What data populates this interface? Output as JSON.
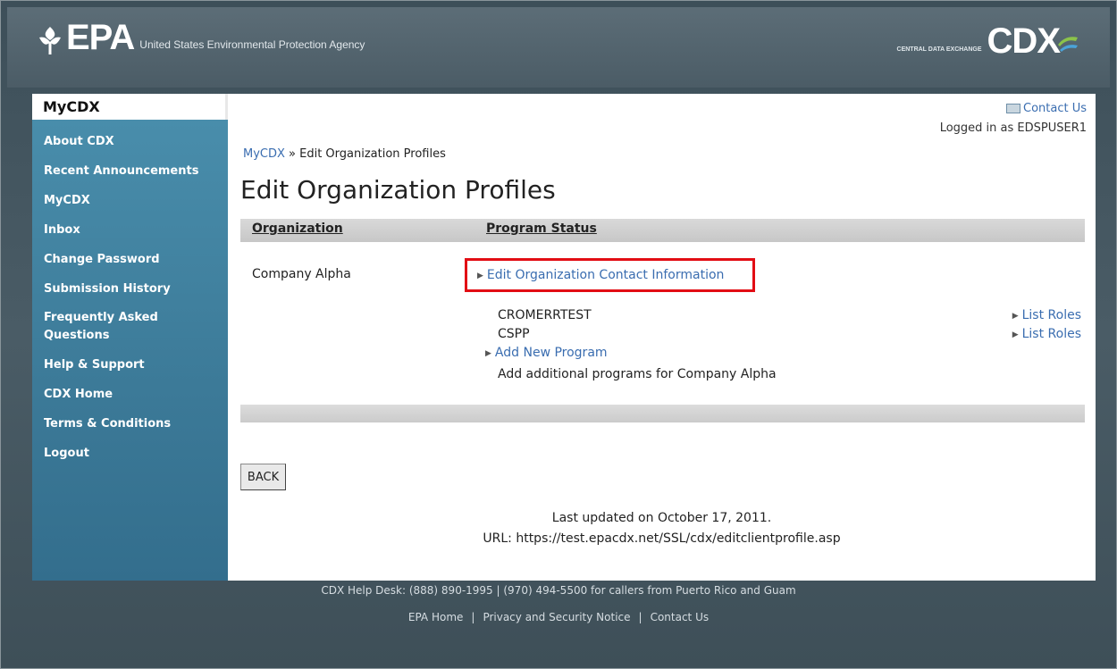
{
  "header": {
    "epa_word": "EPA",
    "epa_name": "United States Environmental Protection Agency",
    "cdx_sub": "CENTRAL DATA EXCHANGE",
    "cdx_word": "CDX"
  },
  "sidebar": {
    "title": "MyCDX",
    "items": [
      {
        "label": "About CDX"
      },
      {
        "label": "Recent Announcements"
      },
      {
        "label": "MyCDX"
      },
      {
        "label": "Inbox"
      },
      {
        "label": "Change Password"
      },
      {
        "label": "Submission History"
      },
      {
        "label": "Frequently Asked Questions"
      },
      {
        "label": "Help & Support"
      },
      {
        "label": "CDX Home"
      },
      {
        "label": "Terms & Conditions"
      },
      {
        "label": "Logout"
      }
    ]
  },
  "top": {
    "contact_us": "Contact Us",
    "logged_in": "Logged in as EDSPUSER1"
  },
  "breadcrumb": {
    "home": "MyCDX",
    "sep": " » ",
    "current": "Edit Organization Profiles"
  },
  "page": {
    "title": "Edit Organization Profiles",
    "col_organization": "Organization",
    "col_program_status": "Program Status",
    "organization": "Company Alpha",
    "edit_link": "Edit Organization Contact Information",
    "programs": [
      {
        "name": "CROMERRTEST",
        "link": "List Roles"
      },
      {
        "name": "CSPP",
        "link": "List Roles"
      }
    ],
    "add_program": "Add New Program",
    "add_note": "Add additional programs for Company Alpha",
    "back": "BACK",
    "last_updated": "Last updated on October 17, 2011.",
    "url": "URL: https://test.epacdx.net/SSL/cdx/editclientprofile.asp"
  },
  "footer": {
    "helpdesk": "CDX Help Desk: (888) 890-1995 | (970) 494-5500 for callers from Puerto Rico and Guam",
    "links": [
      "EPA Home",
      "Privacy and Security Notice",
      "Contact Us"
    ]
  }
}
